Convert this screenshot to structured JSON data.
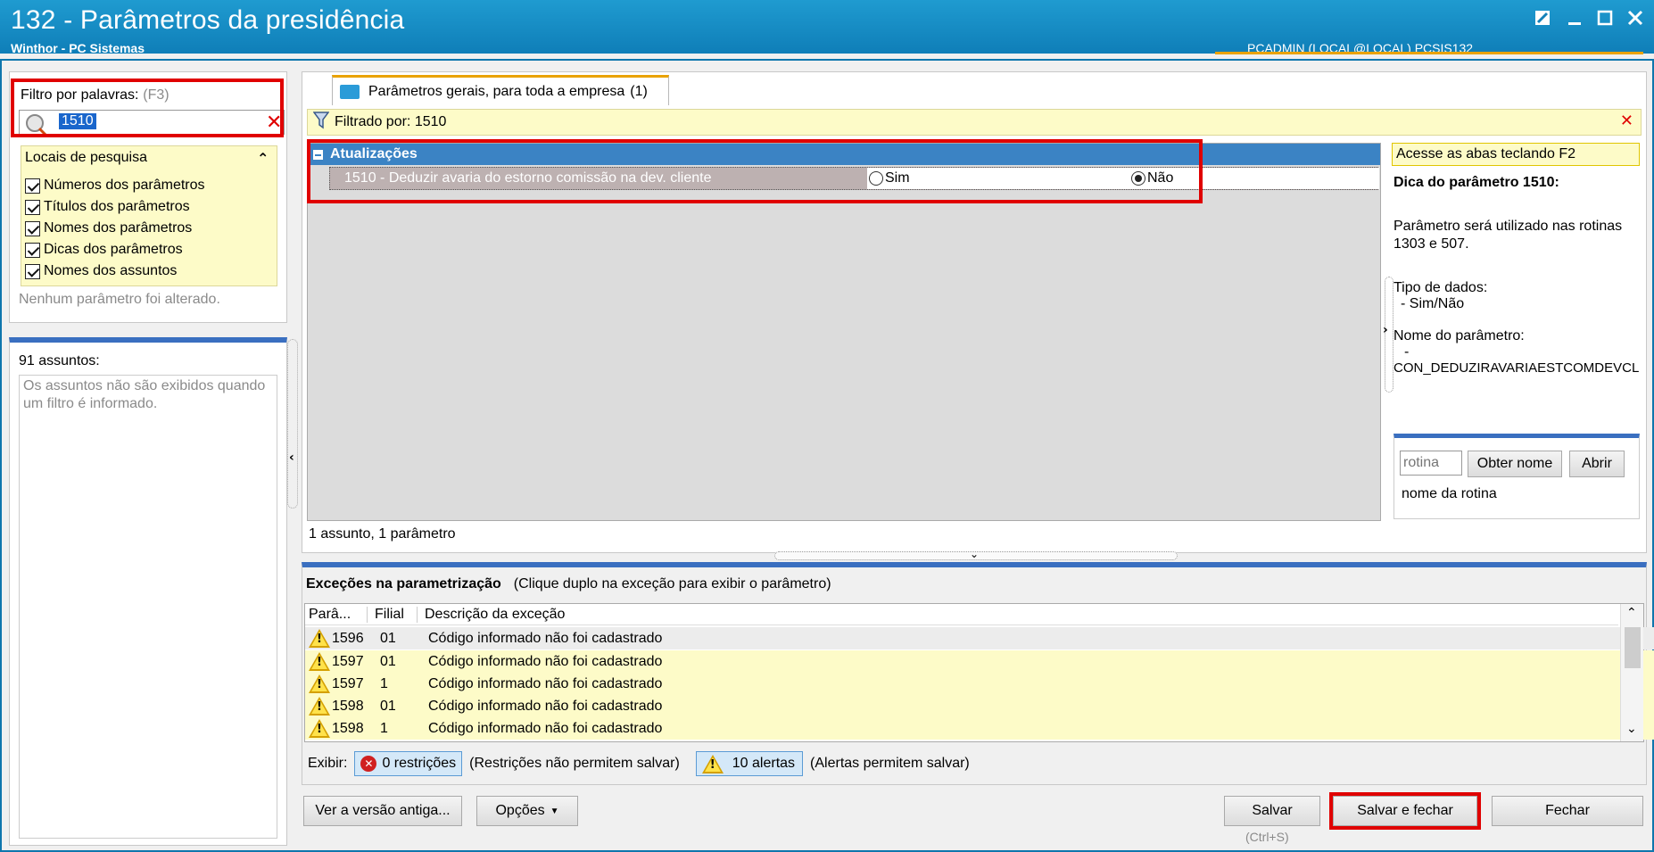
{
  "window": {
    "title": "132 - Parâmetros da presidência",
    "subtitle": "Winthor - PC Sistemas",
    "user_info": "PCADMIN (LOCAL@LOCAL)   PCSIS132",
    "accent_color": "#1a8fc8",
    "highlight_color": "#e00000"
  },
  "filter": {
    "label": "Filtro por palavras:",
    "shortcut": "(F3)",
    "value": "1510"
  },
  "search_locations": {
    "header": "Locais de pesquisa",
    "options": [
      {
        "label": "Números dos parâmetros",
        "checked": true
      },
      {
        "label": "Títulos dos parâmetros",
        "checked": true
      },
      {
        "label": "Nomes dos parâmetros",
        "checked": true
      },
      {
        "label": "Dicas dos parâmetros",
        "checked": true
      },
      {
        "label": "Nomes dos assuntos",
        "checked": true
      }
    ],
    "status": "Nenhum parâmetro foi alterado."
  },
  "subjects": {
    "count_label": "91 assuntos:",
    "message": "Os assuntos não são exibidos quando um filtro é informado."
  },
  "tab": {
    "label": "Parâmetros gerais, para toda a empresa",
    "count": "(1)"
  },
  "filter_bar": {
    "text": "Filtrado por: 1510"
  },
  "group": {
    "title": "Atualizações",
    "param_label": "1510 - Deduzir avaria do estorno comissão na dev. cliente",
    "option_yes": "Sim",
    "option_no": "Não",
    "selected": "Não"
  },
  "summary": "1 assunto, 1 parâmetro",
  "tip": {
    "hint": "Acesse as abas teclando F2",
    "title": "Dica do parâmetro 1510:",
    "description": "Parâmetro será utilizado nas rotinas 1303 e 507.",
    "data_type_label": "Tipo de dados:",
    "data_type_value": "- Sim/Não",
    "name_label": "Nome do parâmetro:",
    "name_dash": "-",
    "name_value": "CON_DEDUZIRAVARIAESTCOMDEVCL",
    "rotina_placeholder": "rotina",
    "get_name_button": "Obter nome",
    "open_button": "Abrir",
    "rotina_name_label": "nome da rotina"
  },
  "exceptions": {
    "title": "Exceções na parametrização",
    "hint": "(Clique duplo na exceção para exibir o parâmetro)",
    "columns": [
      "Parâ...",
      "Filial",
      "Descrição da exceção"
    ],
    "rows": [
      {
        "param": "1596",
        "filial": "01",
        "desc": "Código informado não foi cadastrado"
      },
      {
        "param": "1597",
        "filial": "01",
        "desc": "Código informado não foi cadastrado"
      },
      {
        "param": "1597",
        "filial": "1",
        "desc": "Código informado não foi cadastrado"
      },
      {
        "param": "1598",
        "filial": "01",
        "desc": "Código informado não foi cadastrado"
      },
      {
        "param": "1598",
        "filial": "1",
        "desc": "Código informado não foi cadastrado"
      }
    ],
    "show_label": "Exibir:",
    "restrictions_button": "0 restrições",
    "restrictions_note": "(Restrições não permitem salvar)",
    "alerts_button": "10 alertas",
    "alerts_note": "(Alertas permitem salvar)"
  },
  "footer": {
    "old_version_button": "Ver a versão antiga...",
    "options_button": "Opções",
    "save_button": "Salvar",
    "save_shortcut": "(Ctrl+S)",
    "save_close_button": "Salvar e fechar",
    "close_button": "Fechar"
  }
}
